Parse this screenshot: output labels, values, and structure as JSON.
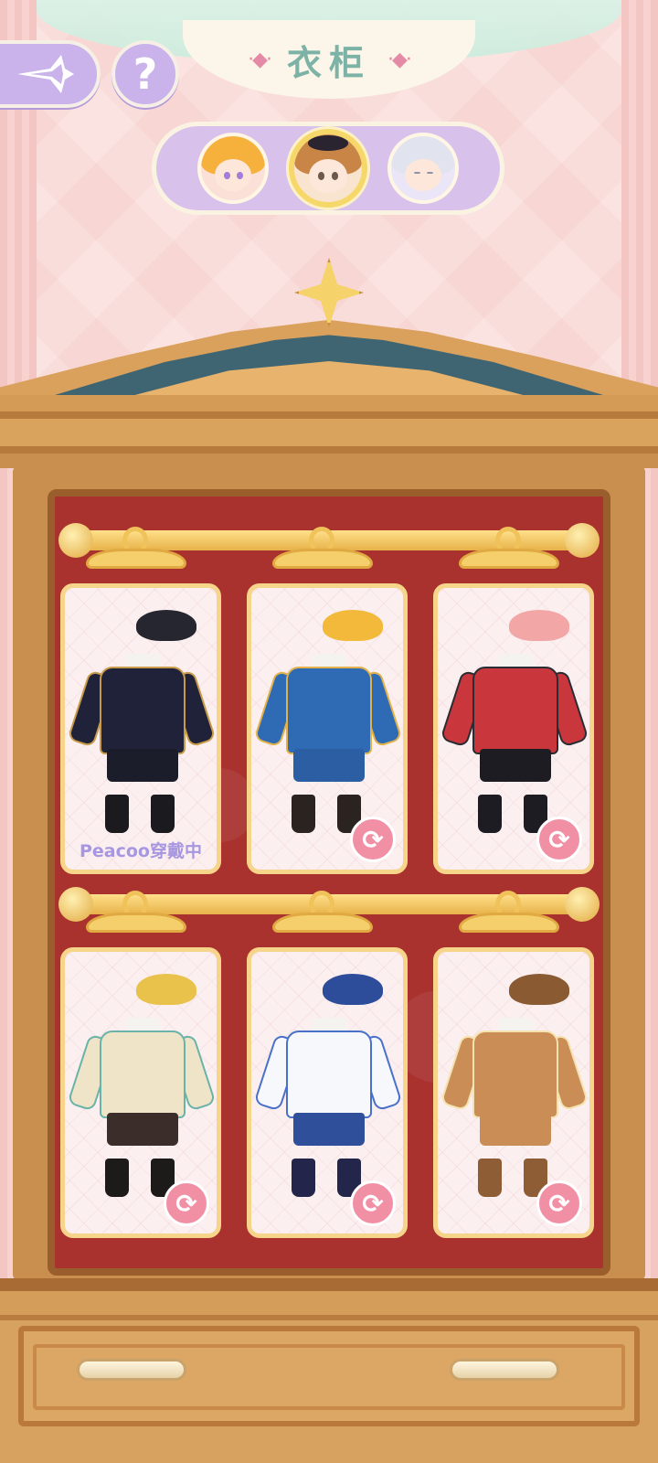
{
  "header": {
    "title": "衣柜",
    "back_icon": "sparkle-star-arrow-icon",
    "help_label": "?"
  },
  "characters": [
    {
      "name": "blonde-girl",
      "selected": false,
      "hair": "#f6b13c",
      "accent": "#f59bb1"
    },
    {
      "name": "beret-boy",
      "selected": true,
      "hair": "#c98545",
      "accent": "#2a2430"
    },
    {
      "name": "silver-girl",
      "selected": false,
      "hair": "#e1e3ee",
      "accent": "#b7a5e6"
    }
  ],
  "outfits": [
    {
      "id": "navy-uniform",
      "wearing": true,
      "wearing_label": "Peacoo穿戴中",
      "hat": "#262630",
      "jacket": "#1f2238",
      "shorts": "#1c1d2a",
      "boots": "#1a1a1f",
      "trim": "#c79b4a"
    },
    {
      "id": "blue-prince",
      "wearing": false,
      "hat": "#f3b93a",
      "jacket": "#2f6bb5",
      "shorts": "#2c5ea3",
      "boots": "#2a2320",
      "trim": "#e2b24a"
    },
    {
      "id": "vampire",
      "wearing": false,
      "hat": "#f3a6a6",
      "jacket": "#c9363c",
      "shorts": "#1c1c22",
      "boots": "#1c1c22",
      "trim": "#2b2b33"
    },
    {
      "id": "qipao",
      "wearing": false,
      "hat": "#e8c24a",
      "jacket": "#efe4c7",
      "shorts": "#3a2d2a",
      "boots": "#1d1b1a",
      "trim": "#6ab3a8"
    },
    {
      "id": "sailor",
      "wearing": false,
      "hat": "#2d4c9a",
      "jacket": "#f7f8fb",
      "shorts": "#2f4f9b",
      "boots": "#23264a",
      "trim": "#4a71c9"
    },
    {
      "id": "reindeer",
      "wearing": false,
      "hat": "#8a5a33",
      "jacket": "#c98d55",
      "shorts": "#c98d55",
      "boots": "#8e5d35",
      "trim": "#f4e3b0"
    }
  ],
  "icons": {
    "swap": "refresh-icon"
  }
}
